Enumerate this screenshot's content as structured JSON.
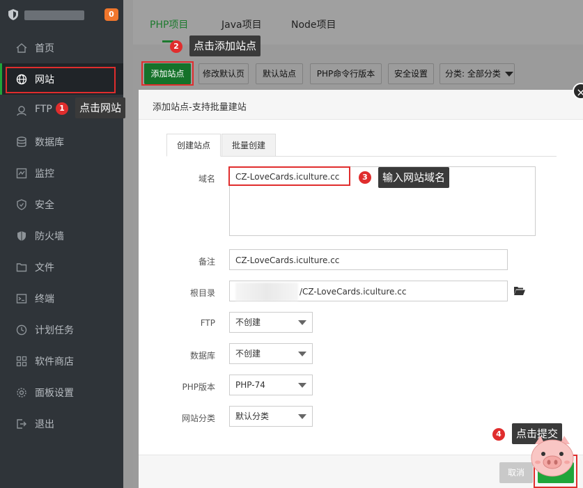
{
  "app": {
    "badge_count": "0"
  },
  "sidebar": {
    "items": [
      {
        "label": "首页",
        "icon": "home-icon"
      },
      {
        "label": "网站",
        "icon": "globe-icon"
      },
      {
        "label": "FTP",
        "icon": "ftp-icon"
      },
      {
        "label": "数据库",
        "icon": "database-icon"
      },
      {
        "label": "监控",
        "icon": "monitor-icon"
      },
      {
        "label": "安全",
        "icon": "shield-icon"
      },
      {
        "label": "防火墙",
        "icon": "firewall-icon"
      },
      {
        "label": "文件",
        "icon": "folder-icon"
      },
      {
        "label": "终端",
        "icon": "terminal-icon"
      },
      {
        "label": "计划任务",
        "icon": "clock-icon"
      },
      {
        "label": "软件商店",
        "icon": "grid-icon"
      },
      {
        "label": "面板设置",
        "icon": "gear-icon"
      },
      {
        "label": "退出",
        "icon": "logout-icon"
      }
    ]
  },
  "header": {
    "tabs": [
      {
        "label": "PHP项目"
      },
      {
        "label": "Java项目"
      },
      {
        "label": "Node项目"
      }
    ]
  },
  "toolbar": {
    "add_site": "添加站点",
    "edit_default_page": "修改默认页",
    "default_site": "默认站点",
    "php_cli_version": "PHP命令行版本",
    "security_settings": "安全设置",
    "category_filter": "分类: 全部分类"
  },
  "modal": {
    "title": "添加站点-支持批量建站",
    "tabs": [
      "创建站点",
      "批量创建"
    ],
    "fields": {
      "domain_label": "域名",
      "domain_value": "CZ-LoveCards.iculture.cc",
      "note_label": "备注",
      "note_value": "CZ-LoveCards.iculture.cc",
      "root_label": "根目录",
      "root_value": "/CZ-LoveCards.iculture.cc",
      "ftp_label": "FTP",
      "ftp_value": "不创建",
      "db_label": "数据库",
      "db_value": "不创建",
      "php_label": "PHP版本",
      "php_value": "PHP-74",
      "category_label": "网站分类",
      "category_value": "默认分类"
    },
    "cancel": "取消",
    "close": "×"
  },
  "annotations": [
    {
      "num": "1",
      "text": "点击网站"
    },
    {
      "num": "2",
      "text": "点击添加站点"
    },
    {
      "num": "3",
      "text": "输入网站域名"
    },
    {
      "num": "4",
      "text": "点击提交"
    }
  ],
  "colors": {
    "accent": "#20a53a",
    "annotation": "#e02d2d",
    "sidebar_bg": "#2f3439"
  }
}
